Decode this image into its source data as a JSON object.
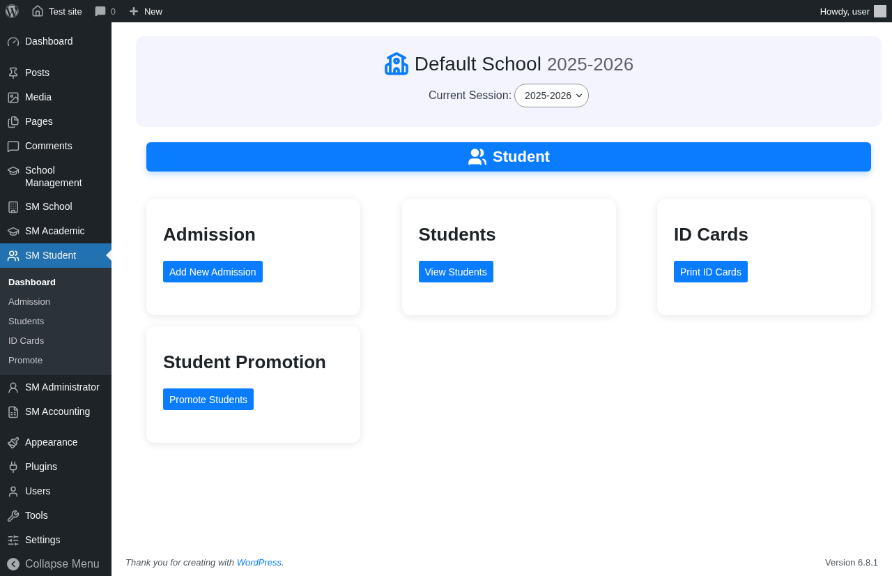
{
  "admin_bar": {
    "site": "Test site",
    "comments": "0",
    "new": "New",
    "greeting": "Howdy, user"
  },
  "sidebar": {
    "items": [
      {
        "kind": "item",
        "label": "Dashboard",
        "selected": false
      },
      {
        "kind": "separator"
      },
      {
        "kind": "item",
        "label": "Posts",
        "selected": false
      },
      {
        "kind": "item",
        "label": "Media",
        "selected": false
      },
      {
        "kind": "item",
        "label": "Pages",
        "selected": false
      },
      {
        "kind": "item",
        "label": "Comments",
        "selected": false
      },
      {
        "kind": "item",
        "label": "School Management",
        "selected": false
      },
      {
        "kind": "item",
        "label": "SM School",
        "selected": false
      },
      {
        "kind": "item",
        "label": "SM Academic",
        "selected": false
      },
      {
        "kind": "item",
        "label": "SM Student",
        "selected": true,
        "children": [
          {
            "label": "Dashboard",
            "selected": true
          },
          {
            "label": "Admission",
            "selected": false
          },
          {
            "label": "Students",
            "selected": false
          },
          {
            "label": "ID Cards",
            "selected": false
          },
          {
            "label": "Promote",
            "selected": false
          }
        ]
      },
      {
        "kind": "item",
        "label": "SM Administrator",
        "selected": false
      },
      {
        "kind": "item",
        "label": "SM Accounting",
        "selected": false
      },
      {
        "kind": "separator"
      },
      {
        "kind": "item",
        "label": "Appearance",
        "selected": false
      },
      {
        "kind": "item",
        "label": "Plugins",
        "selected": false
      },
      {
        "kind": "item",
        "label": "Users",
        "selected": false
      },
      {
        "kind": "item",
        "label": "Tools",
        "selected": false
      },
      {
        "kind": "item",
        "label": "Settings",
        "selected": false
      }
    ],
    "collapse": "Collapse Menu"
  },
  "header": {
    "school": "Default School",
    "session_year": "2025-2026",
    "session_label": "Current Session:",
    "session_value": "2025-2026"
  },
  "section_title": "Student",
  "cards": [
    {
      "title": "Admission",
      "button": "Add New Admission"
    },
    {
      "title": "Students",
      "button": "View Students"
    },
    {
      "title": "ID Cards",
      "button": "Print ID Cards"
    },
    {
      "title": "Student Promotion",
      "button": "Promote Students"
    }
  ],
  "footer": {
    "text": "Thank you for creating with ",
    "link": "WordPress",
    "after": ".",
    "version": "Version 6.8.1"
  }
}
